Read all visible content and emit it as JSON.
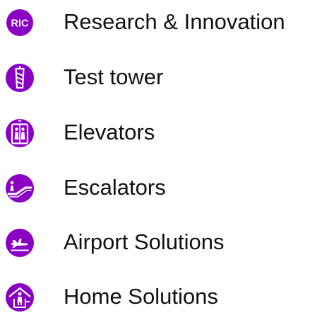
{
  "accent_color": "#8a00c2",
  "items": [
    {
      "label": "Research & Innovation",
      "icon": "ric-icon",
      "icon_text": "RIC"
    },
    {
      "label": "Test tower",
      "icon": "test-tower-icon"
    },
    {
      "label": "Elevators",
      "icon": "elevator-icon"
    },
    {
      "label": "Escalators",
      "icon": "escalator-icon"
    },
    {
      "label": "Airport Solutions",
      "icon": "airplane-icon"
    },
    {
      "label": "Home Solutions",
      "icon": "home-lift-icon"
    }
  ]
}
